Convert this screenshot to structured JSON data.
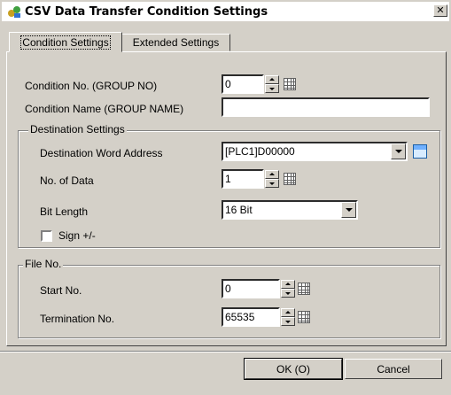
{
  "dialog": {
    "title": "CSV Data Transfer Condition Settings",
    "close_symbol": "✕"
  },
  "tabs": [
    {
      "label": "Condition Settings",
      "active": true
    },
    {
      "label": "Extended Settings",
      "active": false
    }
  ],
  "condition": {
    "no_label": "Condition No. (GROUP NO)",
    "no_value": "0",
    "name_label": "Condition Name (GROUP NAME)",
    "name_value": ""
  },
  "destination": {
    "group_label": "Destination Settings",
    "address_label": "Destination Word Address",
    "address_value": "[PLC1]D00000",
    "count_label": "No. of Data",
    "count_value": "1",
    "bitlen_label": "Bit Length",
    "bitlen_value": "16 Bit",
    "sign_label": "Sign +/-",
    "sign_checked": false
  },
  "file": {
    "group_label": "File No.",
    "start_label": "Start No.",
    "start_value": "0",
    "end_label": "Termination No.",
    "end_value": "65535"
  },
  "buttons": {
    "ok_label": "OK (O)",
    "cancel_label": "Cancel"
  },
  "icons": {
    "app": "csv-transfer-icon",
    "keypad": "keypad-icon",
    "address_book": "address-input-icon"
  }
}
